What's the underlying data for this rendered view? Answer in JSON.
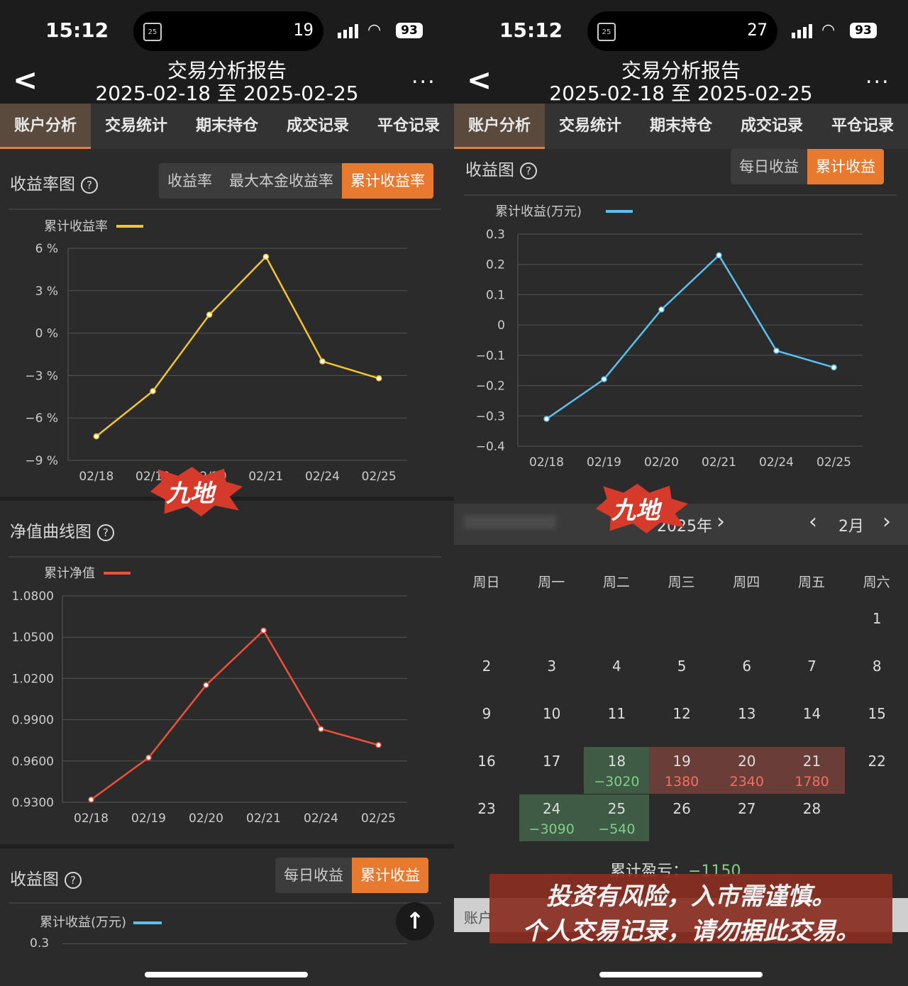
{
  "status": {
    "time": "15:12",
    "cal_icon": "25",
    "left_counter": "19",
    "right_counter": "27",
    "battery": "93"
  },
  "nav": {
    "title": "交易分析报告",
    "date_range": "2025-02-18 至 2025-02-25",
    "more": "..."
  },
  "tabs": [
    "账户分析",
    "交易统计",
    "期末持仓",
    "成交记录",
    "平仓记录"
  ],
  "left": {
    "return_chart": {
      "title": "收益率图",
      "help": "?",
      "seg": [
        "收益率",
        "最大本金收益率",
        "累计收益率"
      ],
      "seg_active": 2
    },
    "nav_chart": {
      "title": "净值曲线图",
      "help": "?"
    },
    "profit_chart": {
      "title": "收益图",
      "help": "?",
      "seg": [
        "每日收益",
        "累计收益"
      ],
      "seg_active": 1,
      "legend": "累计收益(万元)",
      "first_tick": "0.3"
    }
  },
  "right": {
    "profit_chart": {
      "title": "收益图",
      "help": "?",
      "seg": [
        "每日收益",
        "累计收益"
      ],
      "seg_active": 1
    },
    "calendar": {
      "year_label": "2025年",
      "month_label": "2月",
      "weekdays": [
        "周日",
        "周一",
        "周二",
        "周三",
        "周四",
        "周五",
        "周六"
      ],
      "total_label": "累计盈亏：",
      "total_value": "−1150",
      "bottom_tab_partial": "账户"
    }
  },
  "stamp_text": "九地",
  "disclaimer": {
    "line1": "投资有风险，入市需谨慎。",
    "line2": "个人交易记录，请勿据此交易。"
  },
  "colors": {
    "accent": "#e87a30",
    "yellow_line": "#f2c430",
    "red_line": "#f0503a",
    "blue_line": "#5ac0f0",
    "gain": "#f07060",
    "loss": "#7fcf8a"
  },
  "chart_data": [
    {
      "type": "line",
      "title": "",
      "series": [
        {
          "name": "累计收益率",
          "values": [
            -7.3,
            -4.1,
            1.3,
            5.4,
            -2.0,
            -3.2
          ]
        }
      ],
      "categories": [
        "02/18",
        "02/19",
        "02/20",
        "02/21",
        "02/24",
        "02/25"
      ],
      "y_ticks": [
        "6 %",
        "3 %",
        "0 %",
        "−3 %",
        "−6 %",
        "−9 %"
      ],
      "ylim": [
        -9,
        6
      ],
      "grid": true,
      "legend": "top-left"
    },
    {
      "type": "line",
      "title": "",
      "series": [
        {
          "name": "累计净值",
          "values": [
            0.927,
            0.9585,
            1.013,
            1.054,
            0.98,
            0.968
          ]
        }
      ],
      "categories": [
        "02/18",
        "02/19",
        "02/20",
        "02/21",
        "02/24",
        "02/25"
      ],
      "y_ticks": [
        "1.0800",
        "1.0500",
        "1.0200",
        "0.9900",
        "0.9600",
        "0.9300"
      ],
      "ylim": [
        0.925,
        1.08
      ],
      "grid": true,
      "legend": "top-left"
    },
    {
      "type": "line",
      "title": "",
      "series": [
        {
          "name": "累计收益(万元)",
          "values": [
            -0.31,
            -0.179,
            0.051,
            0.23,
            -0.085,
            -0.14
          ]
        }
      ],
      "categories": [
        "02/18",
        "02/19",
        "02/20",
        "02/21",
        "02/24",
        "02/25"
      ],
      "y_ticks": [
        "0.3",
        "0.2",
        "0.1",
        "0",
        "−0.1",
        "−0.2",
        "−0.3",
        "−0.4"
      ],
      "ylim": [
        -0.4,
        0.3
      ],
      "grid": true,
      "legend": "top-left"
    }
  ],
  "calendar_days": [
    {
      "day": "1",
      "col": 6,
      "row": 0
    },
    {
      "day": "2",
      "col": 0,
      "row": 1
    },
    {
      "day": "3",
      "col": 1,
      "row": 1
    },
    {
      "day": "4",
      "col": 2,
      "row": 1
    },
    {
      "day": "5",
      "col": 3,
      "row": 1
    },
    {
      "day": "6",
      "col": 4,
      "row": 1
    },
    {
      "day": "7",
      "col": 5,
      "row": 1
    },
    {
      "day": "8",
      "col": 6,
      "row": 1
    },
    {
      "day": "9",
      "col": 0,
      "row": 2
    },
    {
      "day": "10",
      "col": 1,
      "row": 2
    },
    {
      "day": "11",
      "col": 2,
      "row": 2
    },
    {
      "day": "12",
      "col": 3,
      "row": 2
    },
    {
      "day": "13",
      "col": 4,
      "row": 2
    },
    {
      "day": "14",
      "col": 5,
      "row": 2
    },
    {
      "day": "15",
      "col": 6,
      "row": 2
    },
    {
      "day": "16",
      "col": 0,
      "row": 3
    },
    {
      "day": "17",
      "col": 1,
      "row": 3
    },
    {
      "day": "18",
      "col": 2,
      "row": 3,
      "pnl": "−3020",
      "kind": "loss"
    },
    {
      "day": "19",
      "col": 3,
      "row": 3,
      "pnl": "1380",
      "kind": "gain"
    },
    {
      "day": "20",
      "col": 4,
      "row": 3,
      "pnl": "2340",
      "kind": "gain"
    },
    {
      "day": "21",
      "col": 5,
      "row": 3,
      "pnl": "1780",
      "kind": "gain"
    },
    {
      "day": "22",
      "col": 6,
      "row": 3
    },
    {
      "day": "23",
      "col": 0,
      "row": 4
    },
    {
      "day": "24",
      "col": 1,
      "row": 4,
      "pnl": "−3090",
      "kind": "loss"
    },
    {
      "day": "25",
      "col": 2,
      "row": 4,
      "pnl": "−540",
      "kind": "loss"
    },
    {
      "day": "26",
      "col": 3,
      "row": 4
    },
    {
      "day": "27",
      "col": 4,
      "row": 4
    },
    {
      "day": "28",
      "col": 5,
      "row": 4
    }
  ]
}
